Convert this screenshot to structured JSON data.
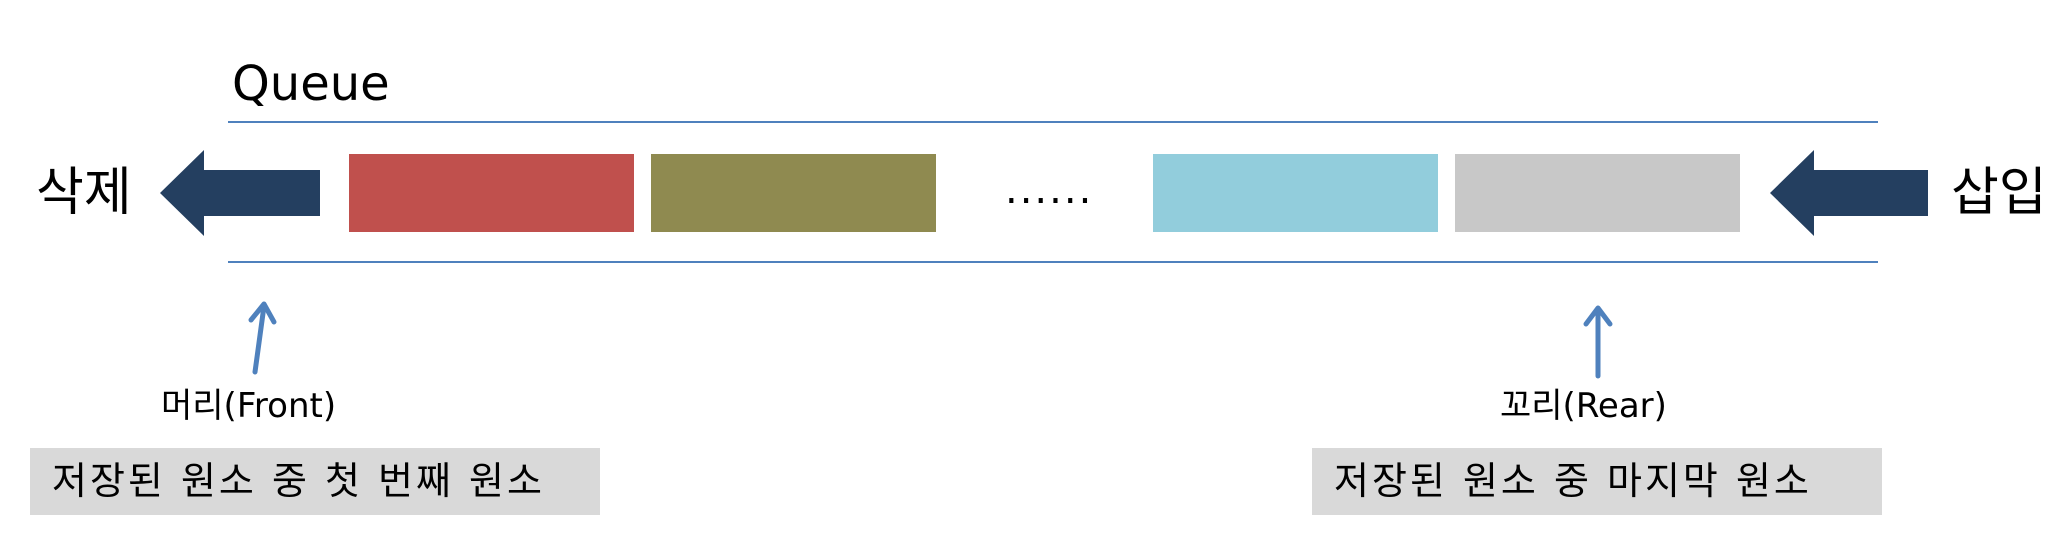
{
  "title": "Queue",
  "delete_label": "삭제",
  "insert_label": "삽입",
  "ellipsis": "......",
  "front": {
    "label": "머리(Front)",
    "description": "저장된 원소 중 첫 번째 원소"
  },
  "rear": {
    "label": "꼬리(Rear)",
    "description": "저장된 원소 중 마지막 원소"
  },
  "colors": {
    "queue_border": "#4f81bd",
    "big_arrow": "#243f60",
    "pointer_arrow": "#4f81bd",
    "description_bg": "#d9d9d9",
    "elements": [
      "#c0504d",
      "#8f8a50",
      "#92cddc",
      "#c8c8c8"
    ]
  }
}
